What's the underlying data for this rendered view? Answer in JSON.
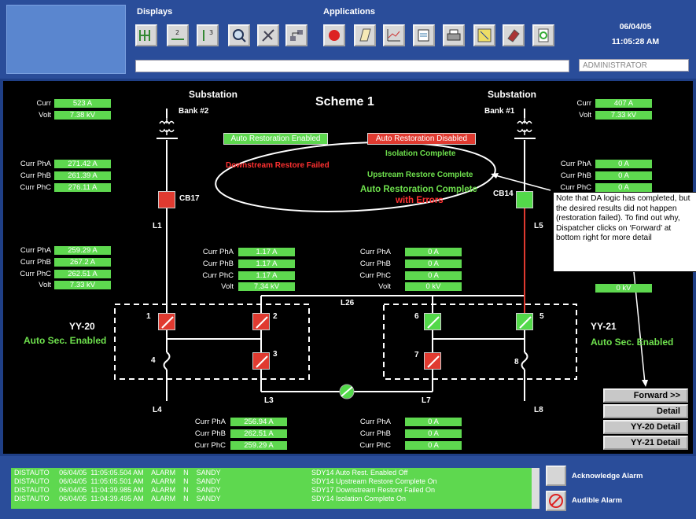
{
  "header": {
    "displays_label": "Displays",
    "applications_label": "Applications",
    "date": "06/04/05",
    "time": "11:05:28 AM",
    "user": "ADMINISTRATOR",
    "display_icons": [
      "one-line-icon",
      "bus-numbers-icon",
      "numbered-list-icon",
      "zoom-icon",
      "satellite-icon",
      "network-icon"
    ],
    "application_icons": [
      "alarm-bell-icon",
      "notepad-icon",
      "trend-chart-icon",
      "report-icon",
      "printer-icon",
      "map-icon",
      "book-icon",
      "refresh-icon"
    ]
  },
  "scheme": {
    "title": "Scheme 1",
    "substation_left": "Substation",
    "substation_right": "Substation",
    "bank_left": "Bank #2",
    "bank_right": "Bank #1",
    "auto_restoration_enabled": "Auto Restoration Enabled",
    "auto_restoration_disabled": "Auto Restoration Disabled",
    "isolation_complete": "Isolation Complete",
    "downstream_failed": "Downstream Restore Failed",
    "upstream_complete": "Upstream Restore Complete",
    "auto_complete_line1": "Auto Restoration Complete",
    "auto_complete_line2": "with Errors",
    "left_bank": {
      "curr_label": "Curr",
      "curr": "523 A",
      "volt_label": "Volt",
      "volt": "7.38 kV"
    },
    "right_bank": {
      "curr_label": "Curr",
      "curr": "407 A",
      "volt_label": "Volt",
      "volt": "7.33 kV"
    },
    "cb17_group": {
      "a_label": "Curr PhA",
      "a": "271.42 A",
      "b_label": "Curr PhB",
      "b": "261.39 A",
      "c_label": "Curr PhC",
      "c": "276.11 A"
    },
    "cb14_group": {
      "a_label": "Curr PhA",
      "a": "0 A",
      "b_label": "Curr PhB",
      "b": "0 A",
      "c_label": "Curr PhC",
      "c": "0 A"
    },
    "l1_group": {
      "a_label": "Curr PhA",
      "a": "259.29 A",
      "b_label": "Curr PhB",
      "b": "267.2 A",
      "c_label": "Curr PhC",
      "c": "262.51 A",
      "v_label": "Volt",
      "v": "7.33 kV"
    },
    "mid_left_group": {
      "a_label": "Curr PhA",
      "a": "1.17 A",
      "b_label": "Curr PhB",
      "b": "1.17 A",
      "c_label": "Curr PhC",
      "c": "1.17 A",
      "v_label": "Volt",
      "v": "7.34 kV"
    },
    "mid_right_group": {
      "a_label": "Curr PhA",
      "a": "0 A",
      "b_label": "Curr PhB",
      "b": "0 A",
      "c_label": "Curr PhC",
      "c": "0 A",
      "v_label": "Volt",
      "v": "0 kV"
    },
    "right_volt": "0 kV",
    "bottom_left_group": {
      "a_label": "Curr PhA",
      "a": "256.94 A",
      "b_label": "Curr PhB",
      "b": "262.51 A",
      "c_label": "Curr PhC",
      "c": "259.29 A"
    },
    "bottom_right_group": {
      "a_label": "Curr PhA",
      "a": "0 A",
      "b_label": "Curr PhB",
      "b": "0 A",
      "c_label": "Curr PhC",
      "c": "0 A"
    },
    "cb17": "CB17",
    "cb14": "CB14",
    "lines": {
      "l1": "L1",
      "l3": "L3",
      "l4": "L4",
      "l5": "L5",
      "l7": "L7",
      "l8": "L8",
      "l26": "L26"
    },
    "switch_numbers": {
      "s1": "1",
      "s2": "2",
      "s3": "3",
      "s4": "4",
      "s5": "5",
      "s6": "6",
      "s7": "7",
      "s8": "8"
    },
    "yy20": "YY-20",
    "yy20_status": "Auto Sec. Enabled",
    "yy21": "YY-21",
    "yy21_status": "Auto Sec. Enabled",
    "buttons": {
      "forward": "Forward >>",
      "detail": "Detail",
      "yy20_detail": "YY-20 Detail",
      "yy21_detail": "YY-21 Detail"
    },
    "callout": "Note that DA logic has completed, but the desired results did not happen (restoration failed).  To find out why, Dispatcher clicks on ‘Forward’ at bottom right for more detail"
  },
  "alarms": {
    "rows": [
      "DISTAUTO     06/04/05  11:05:05.504 AM    ALARM    N    SANDY",
      "DISTAUTO     06/04/05  11:05:05.501 AM    ALARM    N    SANDY",
      "DISTAUTO     06/04/05  11:04:39.985 AM    ALARM    N    SANDY",
      "DISTAUTO     06/04/05  11:04:39.495 AM    ALARM    N    SANDY"
    ],
    "messages": [
      "SDY14 Auto Rest. Enabled Off",
      "SDY14 Upstream Restore Complete On",
      "SDY17 Downstream Restore Failed On",
      "SDY14 Isolation Complete On"
    ],
    "acknowledge": "Acknowledge Alarm",
    "audible": "Audible Alarm"
  },
  "colors": {
    "alarm_green": "#5ed84f",
    "switch_red": "#e03a30",
    "switch_green": "#53d94a"
  }
}
